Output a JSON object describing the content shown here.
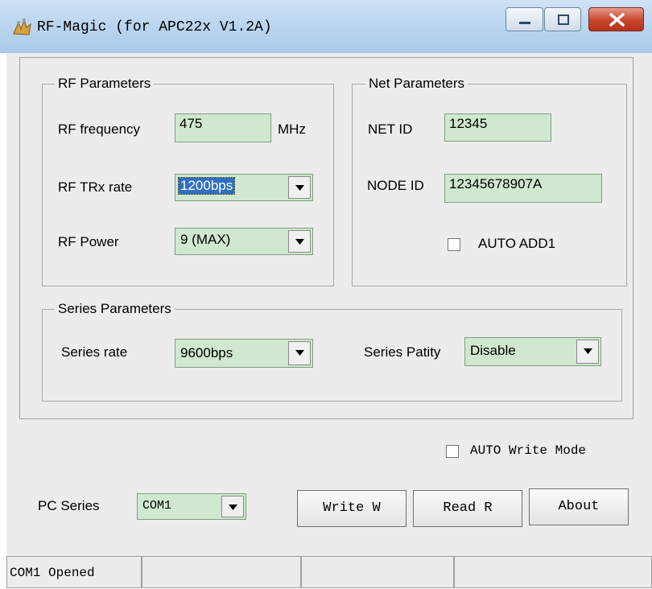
{
  "window": {
    "title": "RF-Magic (for APC22x V1.2A)",
    "icons": [
      "app-icon",
      "minimize-icon",
      "maximize-icon",
      "close-icon"
    ]
  },
  "rf": {
    "group_title": "RF Parameters",
    "frequency_label": "RF frequency",
    "frequency_value": "475",
    "frequency_unit": "MHz",
    "rate_label": "RF TRx rate",
    "rate_value": "1200bps",
    "power_label": "RF Power",
    "power_value": "9 (MAX)"
  },
  "net": {
    "group_title": "Net Parameters",
    "netid_label": "NET ID",
    "netid_value": "12345",
    "nodeid_label": "NODE ID",
    "nodeid_value": "12345678907A",
    "autoadd_label": "AUTO ADD1"
  },
  "series": {
    "group_title": "Series Parameters",
    "rate_label": "Series rate",
    "rate_value": "9600bps",
    "parity_label": "Series Patity",
    "parity_value": "Disable"
  },
  "bottom": {
    "auto_write_label": "AUTO Write Mode",
    "pc_series_label": "PC Series",
    "pc_series_value": "COM1",
    "write_button": "Write W",
    "read_button": "Read R",
    "about_button": "About"
  },
  "statusbar": {
    "text": "COM1 Opened"
  },
  "colors": {
    "field_bg": "#cfe8cf",
    "selection": "#2f6fc3",
    "close_button": "#c8432c"
  }
}
